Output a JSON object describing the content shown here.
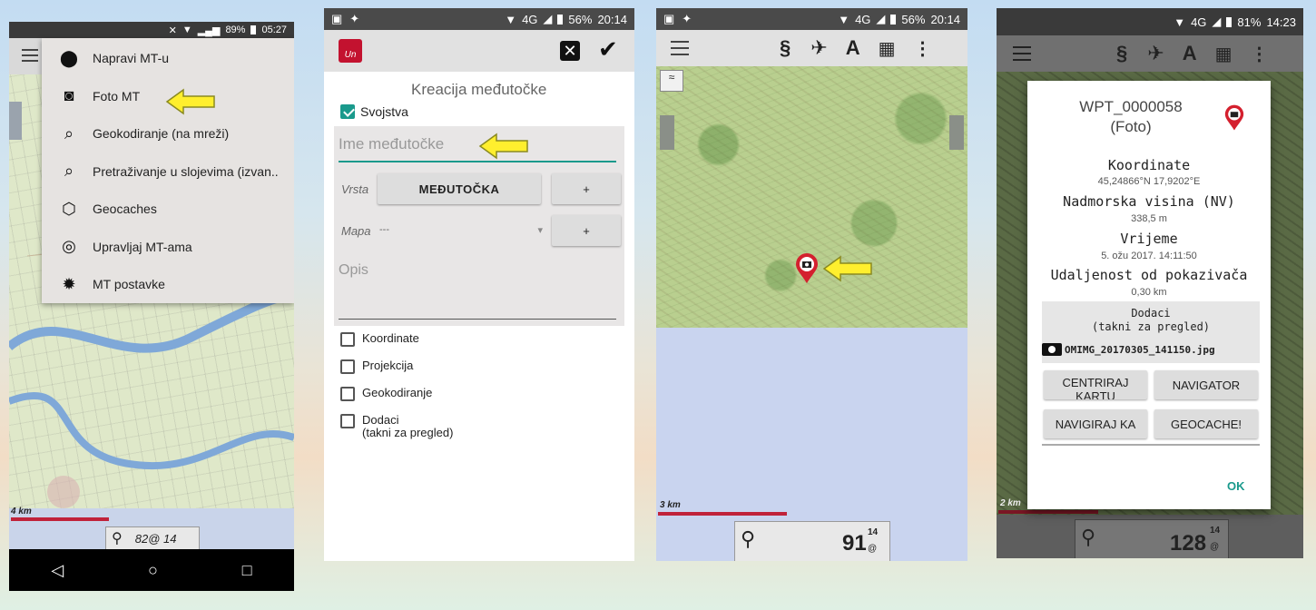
{
  "screen1": {
    "status": {
      "battery": "89%",
      "time": "05:27"
    },
    "menu": [
      {
        "label": "Napravi MT-u",
        "icon": "location-pin-icon"
      },
      {
        "label": "Foto MT",
        "icon": "camera-icon"
      },
      {
        "label": "Geokodiranje (na mreži)",
        "icon": "search-globe-icon"
      },
      {
        "label": "Pretraživanje u slojevima (izvan..",
        "icon": "search-globe-icon"
      },
      {
        "label": "Geocaches",
        "icon": "geocache-icon"
      },
      {
        "label": "Upravljaj MT-ama",
        "icon": "manage-pin-icon"
      },
      {
        "label": "MT postavke",
        "icon": "gear-icon"
      }
    ],
    "scale_label": "4 km",
    "zoom_readout": "82@ 14"
  },
  "screen2": {
    "status": {
      "network": "4G",
      "battery": "56%",
      "time": "20:14"
    },
    "form_title": "Kreacija međutočke",
    "properties_label": "Svojstva",
    "name_placeholder": "Ime međutočke",
    "type_label": "Vrsta",
    "type_value": "MEĐUTOČKA",
    "plus_label": "+",
    "map_label": "Mapa",
    "map_value": "---",
    "description_placeholder": "Opis",
    "checkboxes": [
      {
        "label": "Koordinate"
      },
      {
        "label": "Projekcija"
      },
      {
        "label": "Geokodiranje"
      },
      {
        "label": "Dodaci\n(takni za pregled)"
      }
    ]
  },
  "screen3": {
    "status": {
      "network": "4G",
      "battery": "56%",
      "time": "20:14"
    },
    "scale_label": "3 km",
    "zoom_main": "91",
    "zoom_sup": "14",
    "zoom_sub": "@"
  },
  "screen4": {
    "status": {
      "network": "4G",
      "battery": "81%",
      "time": "14:23"
    },
    "dialog": {
      "title": "WPT_0000058\n(Foto)",
      "coords_label": "Koordinate",
      "coords_value": "45,24866°N 17,9202°E",
      "elev_label": "Nadmorska visina (NV)",
      "elev_value": "338,5 m",
      "time_label": "Vrijeme",
      "time_value": "5. ožu 2017. 14:11:50",
      "dist_label": "Udaljenost od pokazivača",
      "dist_value": "0,30 km",
      "attach_title": "Dodaci\n(takni za pregled)",
      "attach_file": "OMIMG_20170305_141150.jpg",
      "btn_center": "CENTRIRAJ KARTU",
      "btn_navigator": "NAVIGATOR",
      "btn_navigate_to": "NAVIGIRAJ KA",
      "btn_geocache": "GEOCACHE!",
      "btn_ok": "OK"
    },
    "scale_label": "2 km",
    "zoom_main": "128",
    "zoom_sup": "14",
    "zoom_sub": "@"
  },
  "colors": {
    "teal": "#1a9a8c",
    "scale_red": "#c0223a",
    "arrow_yellow": "#ffef2e"
  }
}
